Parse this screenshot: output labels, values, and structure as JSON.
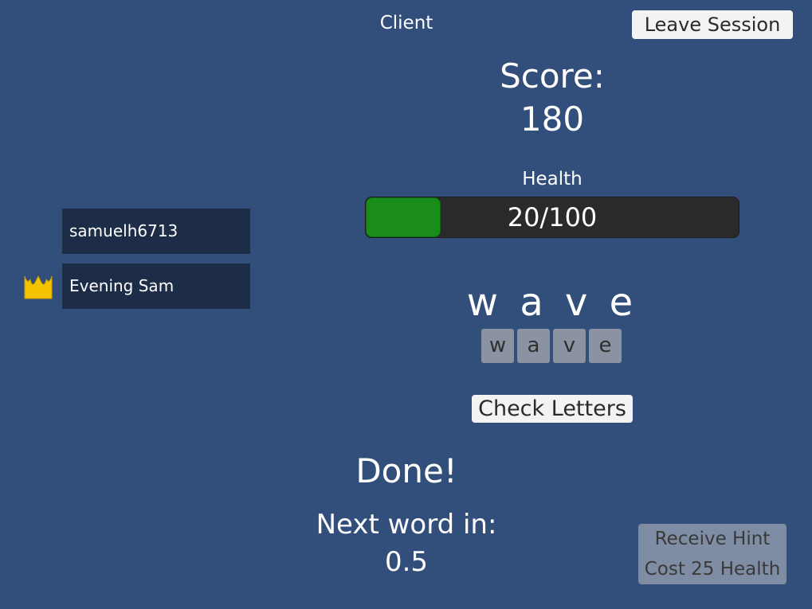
{
  "header": {
    "role_label": "Client",
    "leave_button": "Leave Session"
  },
  "score": {
    "label": "Score:",
    "value": "180"
  },
  "health": {
    "label": "Health",
    "text": "20/100",
    "fraction": 0.2,
    "fill_color": "#1a8c1a"
  },
  "players": [
    {
      "name": "samuelh6713",
      "is_host": false
    },
    {
      "name": "Evening Sam",
      "is_host": true,
      "icon": "crown-icon"
    }
  ],
  "word": {
    "display": "w a v e",
    "tiles": [
      "w",
      "a",
      "v",
      "e"
    ]
  },
  "check_button": "Check Letters",
  "status": {
    "done_text": "Done!",
    "next_label": "Next word in:",
    "next_value": "0.5"
  },
  "hint": {
    "line1": "Receive Hint",
    "line2": "Cost 25 Health"
  },
  "colors": {
    "background": "#324f7b",
    "panel": "#1d2d48",
    "crown": "#f5c400"
  }
}
